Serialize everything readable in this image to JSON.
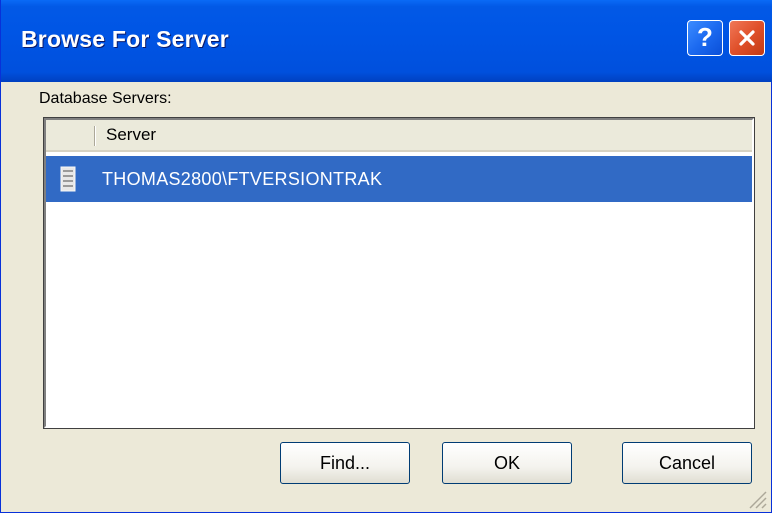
{
  "window": {
    "title": "Browse For Server",
    "help_glyph": "?",
    "close_icon": "close-x-icon"
  },
  "list": {
    "label": "Database Servers:",
    "columns": [
      "",
      "Server"
    ],
    "rows": [
      {
        "icon": "server-icon",
        "name": "THOMAS2800\\FTVERSIONTRAK",
        "selected": true
      }
    ]
  },
  "buttons": {
    "find": "Find...",
    "ok": "OK",
    "cancel": "Cancel"
  },
  "colors": {
    "titlebar": "#0055e5",
    "selection": "#316ac5",
    "dialog_bg": "#ece9d8"
  }
}
